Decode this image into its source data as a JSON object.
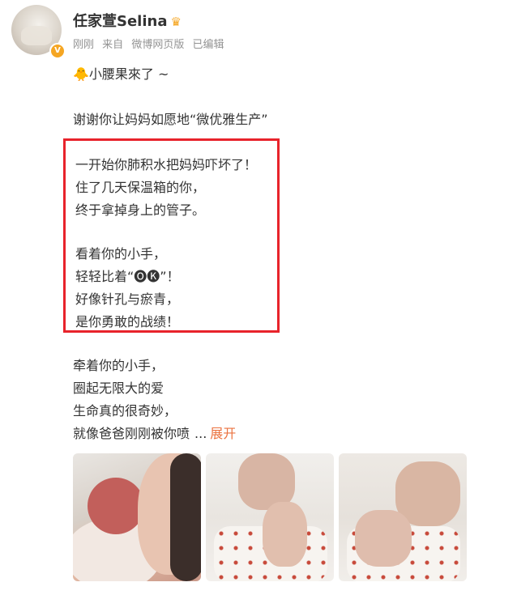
{
  "profile": {
    "name": "任家萱Selina",
    "crown_icon": "crown-icon",
    "verified_badge_icon": "verified-badge-icon",
    "meta": [
      "刚刚",
      "来自",
      "微博网页版",
      "已编辑"
    ]
  },
  "post": {
    "line1": "🐥小腰果來了 ~",
    "line2": "谢谢你让妈妈如愿地“微优雅生产”",
    "highlight": [
      "一开始你肺积水把妈妈吓坏了！",
      "住了几天保温箱的你，",
      "终于拿掉身上的管子。",
      "看着你的小手，",
      "轻轻比着“🅞🅚”！",
      "好像针孔与瘀青，",
      "是你勇敢的战绩！"
    ],
    "after": [
      "牵着你的小手，",
      "圈起无限大的爱",
      "生命真的很奇妙，",
      "就像爸爸刚刚被你喷"
    ],
    "ellipsis": "...",
    "expand_label": "展开"
  },
  "photos": [
    "baby-photo-1",
    "baby-photo-2",
    "baby-photo-3"
  ]
}
